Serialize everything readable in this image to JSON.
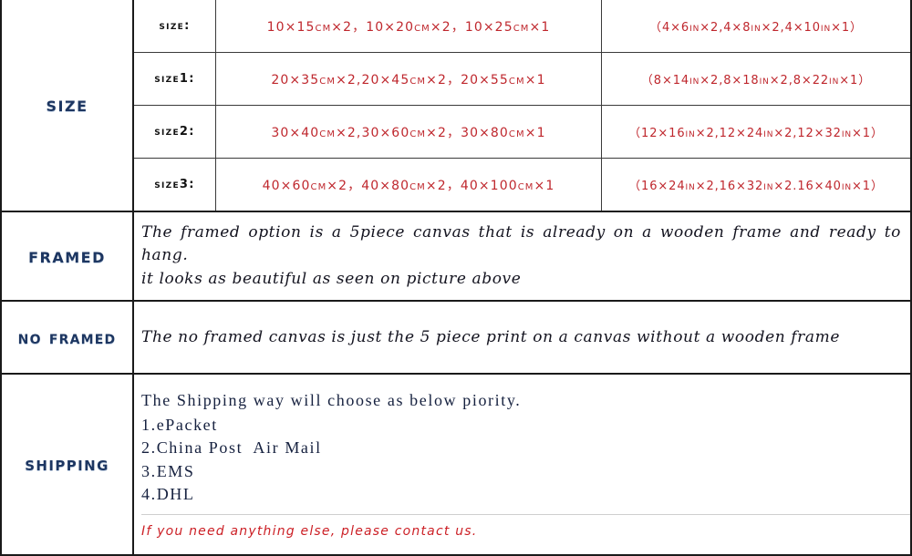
{
  "sections": {
    "size": {
      "label": "Size",
      "rows": [
        {
          "key": "size:",
          "cm": "10×15cm×2，10×20cm×2，10×25cm×1",
          "inch": "（4×6in×2,4×8in×2,4×10in×1）"
        },
        {
          "key": "size1:",
          "cm": "20×35cm×2,20×45cm×2，20×55cm×1",
          "inch": "（8×14in×2,8×18in×2,8×22in×1）"
        },
        {
          "key": "size2:",
          "cm": "30×40cm×2,30×60cm×2，30×80cm×1",
          "inch": "（12×16in×2,12×24in×2,12×32in×1）"
        },
        {
          "key": "size3:",
          "cm": "40×60cm×2，40×80cm×2，40×100cm×1",
          "inch": "（16×24in×2,16×32in×2.16×40in×1）"
        }
      ]
    },
    "framed": {
      "label": "Framed",
      "line1": "The framed option is a 5piece canvas that is already on a wooden frame and ready to hang.",
      "line2": "it looks as beautiful as seen on picture above"
    },
    "no_framed": {
      "label": "No Framed",
      "line1": "The no framed canvas is just the 5 piece print on a canvas without a wooden frame"
    },
    "shipping": {
      "label": "Shipping",
      "heading": "The Shipping way will choose as below piority.",
      "items": [
        "1.ePacket",
        "2.China Post  Air Mail",
        "3.EMS",
        "4.DHL"
      ],
      "footer": "If you need anything else, please contact us."
    }
  },
  "colors": {
    "label_navy": "#1d3661",
    "measure_red": "#bf272d",
    "footer_red": "#cc2026",
    "border_dark": "#1a1a1a",
    "divider_gray": "#cfcfcf"
  }
}
